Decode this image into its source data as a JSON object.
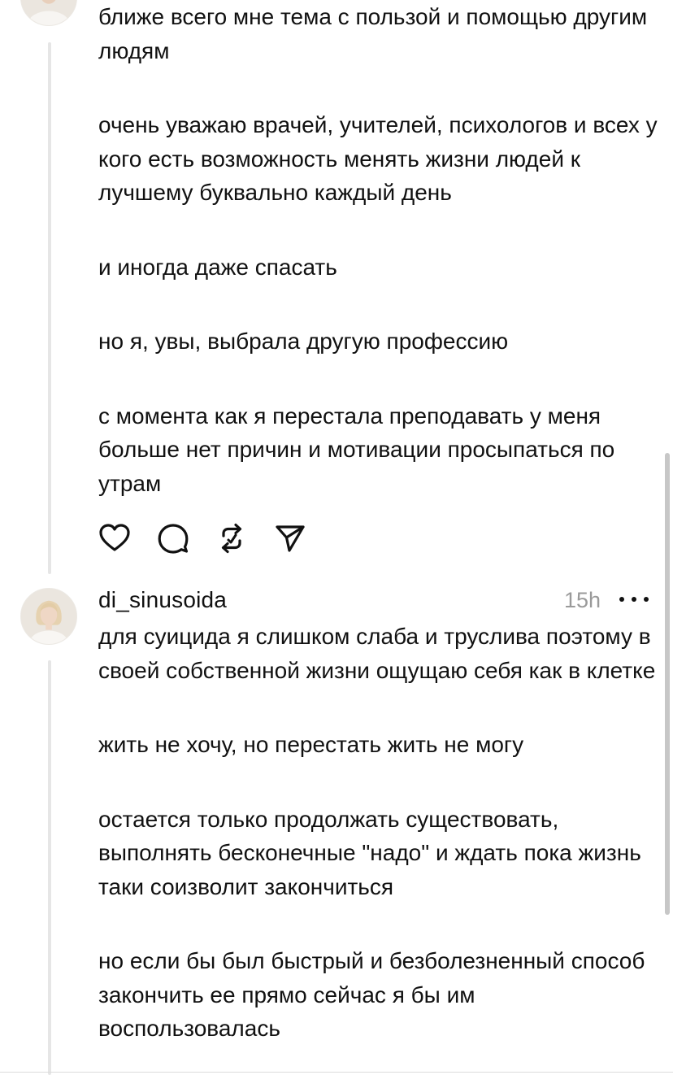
{
  "post1": {
    "paragraphs": [
      "ближе всего мне тема с пользой и помощью другим людям",
      "очень уважаю врачей, учителей, психологов и всех у кого есть возможность менять жизни людей к лучшему буквально каждый день",
      "и иногда даже спасать",
      "но я, увы, выбрала другую профессию",
      "с момента как я перестала преподавать у меня больше нет причин и мотивации просыпаться по утрам"
    ],
    "actions": [
      "heart-icon",
      "comment-icon",
      "repost-icon",
      "send-icon"
    ]
  },
  "post2": {
    "username": "di_sinusoida",
    "time": "15h",
    "paragraphs": [
      "для суицида я слишком слаба и труслива поэтому в своей собственной жизни ощущаю себя как в клетке",
      "жить не хочу, но перестать жить не могу",
      "остается только продолжать существовать, выполнять бесконечные \"надо\" и ждать пока жизнь таки соизволит закончиться",
      "но если бы был быстрый и безболезненный способ закончить ее прямо сейчас я бы им воспользовалась"
    ]
  },
  "colors": {
    "text": "#111111",
    "muted": "#9a9a9a",
    "thread_line": "#e6e6e6",
    "scrollbar": "#c7c7c7",
    "background": "#ffffff"
  }
}
